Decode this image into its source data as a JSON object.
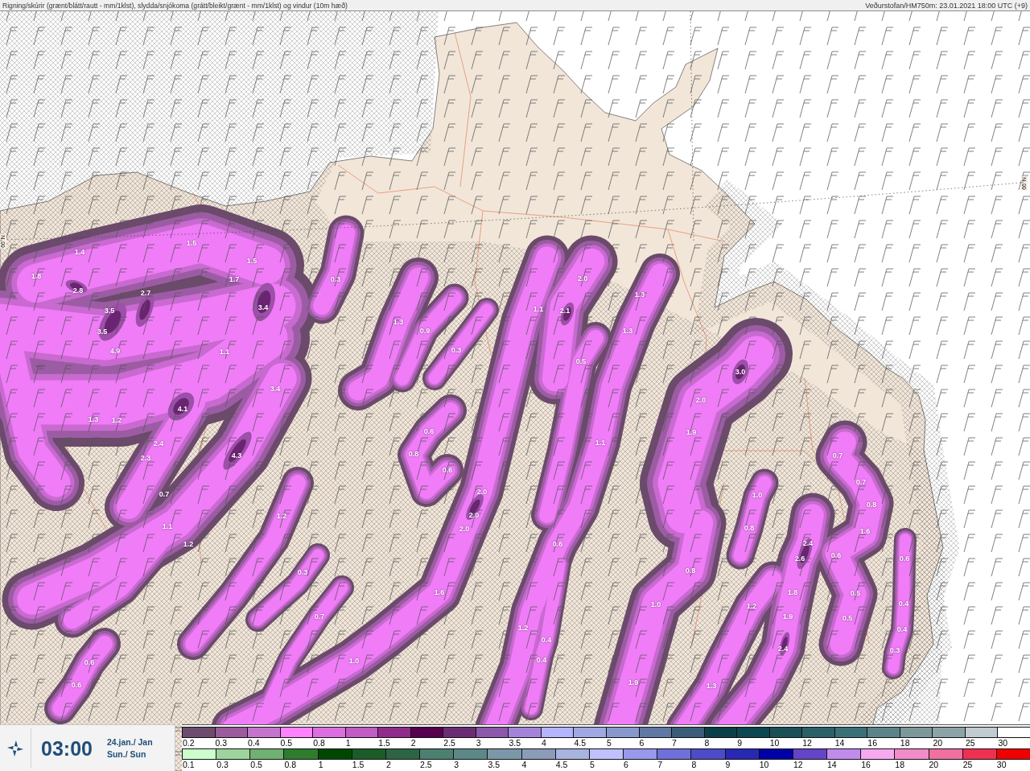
{
  "header": {
    "title": "Rigning/skúrir (grænt/blátt/rautt - mm/1klst), slydda/snjókoma (grátt/bleikt/grænt - mm/1klst) og vindur (10m hæð)",
    "source": "Veðurstofan/HM750m: 23.01.2021 18:00 UTC (+9)"
  },
  "map": {
    "latitude_labels": [
      "66°N",
      "66°N"
    ],
    "precipitation_labels": [
      "1.5",
      "1.4",
      "1.5",
      "1.8",
      "1.7",
      "0.3",
      "2.0",
      "2.8",
      "2.7",
      "1.3",
      "3.5",
      "3.4",
      "1.1",
      "2.1",
      "1.3",
      "3.5",
      "0.9",
      "1.3",
      "4.9",
      "1.1",
      "0.3",
      "0.5",
      "3.0",
      "3.4",
      "2.0",
      "4.1",
      "1.3",
      "1.2",
      "0.6",
      "1.9",
      "2.4",
      "1.1",
      "2.3",
      "4.3",
      "0.8",
      "0.7",
      "0.6",
      "0.7",
      "0.7",
      "2.0",
      "1.0",
      "0.8",
      "1.2",
      "2.0",
      "1.1",
      "2.0",
      "0.8",
      "1.6",
      "1.2",
      "0.6",
      "2.4",
      "2.6",
      "0.6",
      "0.6",
      "0.3",
      "0.8",
      "1.6",
      "1.8",
      "0.5",
      "1.0",
      "1.2",
      "0.4",
      "0.7",
      "1.9",
      "0.5",
      "1.2",
      "0.4",
      "0.4",
      "2.4",
      "0.3",
      "0.6",
      "1.0",
      "0.4",
      "0.6",
      "1.9",
      "1.3"
    ]
  },
  "footer": {
    "time": "03:00",
    "date": "24.jan./ Jan",
    "weekday": "Sun./ Sun"
  },
  "legend": [
    {
      "items": [
        {
          "label": "0.2",
          "color": "#6e4c6e"
        },
        {
          "label": "0.3",
          "color": "#9a5c9c"
        },
        {
          "label": "0.4",
          "color": "#c474cc"
        },
        {
          "label": "0.5",
          "color": "#ff82ff"
        },
        {
          "label": "0.8",
          "color": "#dc6ee0"
        },
        {
          "label": "1",
          "color": "#c05cc4"
        },
        {
          "label": "1.5",
          "color": "#902c8c"
        },
        {
          "label": "2",
          "color": "#580050"
        },
        {
          "label": "2.5",
          "color": "#6c2c74"
        },
        {
          "label": "3",
          "color": "#8c58ac"
        },
        {
          "label": "3.5",
          "color": "#a484d8"
        },
        {
          "label": "4",
          "color": "#b4b4ff"
        },
        {
          "label": "4.5",
          "color": "#a0a8e4"
        },
        {
          "label": "5",
          "color": "#8898cc"
        },
        {
          "label": "6",
          "color": "#6078a4"
        },
        {
          "label": "7",
          "color": "#3c5c78"
        },
        {
          "label": "8",
          "color": "#0c4048"
        },
        {
          "label": "9",
          "color": "#0c4850"
        },
        {
          "label": "10",
          "color": "#1c5058"
        },
        {
          "label": "12",
          "color": "#2c6068"
        },
        {
          "label": "14",
          "color": "#3c7078"
        },
        {
          "label": "16",
          "color": "#5c8488"
        },
        {
          "label": "18",
          "color": "#7c9898"
        },
        {
          "label": "20",
          "color": "#8ca4a8"
        },
        {
          "label": "25",
          "color": "#c0ccd0"
        },
        {
          "label": "30",
          "color": "#ffffff"
        }
      ]
    },
    {
      "items": [
        {
          "label": "0.1",
          "color": "#ccffcc"
        },
        {
          "label": "0.3",
          "color": "#9cd49c"
        },
        {
          "label": "0.5",
          "color": "#70b070"
        },
        {
          "label": "0.8",
          "color": "#2e7c2e"
        },
        {
          "label": "1",
          "color": "#004800"
        },
        {
          "label": "1.5",
          "color": "#1c5c28"
        },
        {
          "label": "2",
          "color": "#2c6444"
        },
        {
          "label": "2.5",
          "color": "#4c8070"
        },
        {
          "label": "3",
          "color": "#5c8888"
        },
        {
          "label": "3.5",
          "color": "#7c98a8"
        },
        {
          "label": "4",
          "color": "#8a9cb8"
        },
        {
          "label": "4.5",
          "color": "#a8b4e0"
        },
        {
          "label": "5",
          "color": "#c0c0ff"
        },
        {
          "label": "6",
          "color": "#9898ec"
        },
        {
          "label": "7",
          "color": "#7070dc"
        },
        {
          "label": "8",
          "color": "#4c4cc8"
        },
        {
          "label": "9",
          "color": "#2828b4"
        },
        {
          "label": "10",
          "color": "#0000a8"
        },
        {
          "label": "12",
          "color": "#6444c8"
        },
        {
          "label": "14",
          "color": "#c08cec"
        },
        {
          "label": "16",
          "color": "#f8a8f0"
        },
        {
          "label": "18",
          "color": "#f08cc8"
        },
        {
          "label": "20",
          "color": "#f070a0"
        },
        {
          "label": "25",
          "color": "#f03050"
        },
        {
          "label": "30",
          "color": "#f00000"
        }
      ]
    }
  ]
}
